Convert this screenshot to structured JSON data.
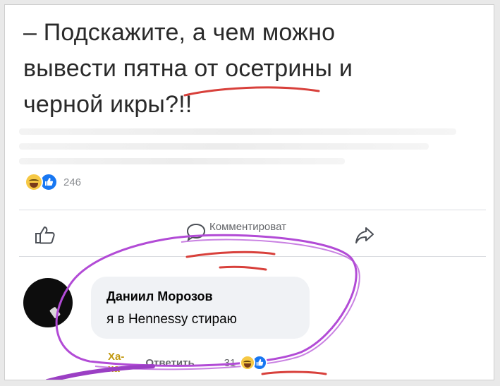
{
  "post": {
    "text_lines": [
      "– Подскажите, а чем можно",
      "вывести пятна от осетрины и",
      "черной икры?!!"
    ],
    "reaction_count": "246",
    "reaction_icons": [
      "haha-emoji-icon",
      "like-badge-icon"
    ]
  },
  "actions": {
    "like_icon": "thumbs-up-outline-icon",
    "comment_icon": "speech-bubble-icon",
    "comment_label": "Комментироват",
    "share_icon": "share-arrow-icon"
  },
  "comment": {
    "author": "Даниил Морозов",
    "text": "я в Hennessy стираю",
    "haha_label": "Ха-ха",
    "reply_label": "Ответить",
    "reaction_count": "31"
  },
  "colors": {
    "like_blue": "#1877f2",
    "haha_yellow": "#f6c844",
    "annotation_purple": "#b24bd6",
    "annotation_red": "#d8403b"
  }
}
